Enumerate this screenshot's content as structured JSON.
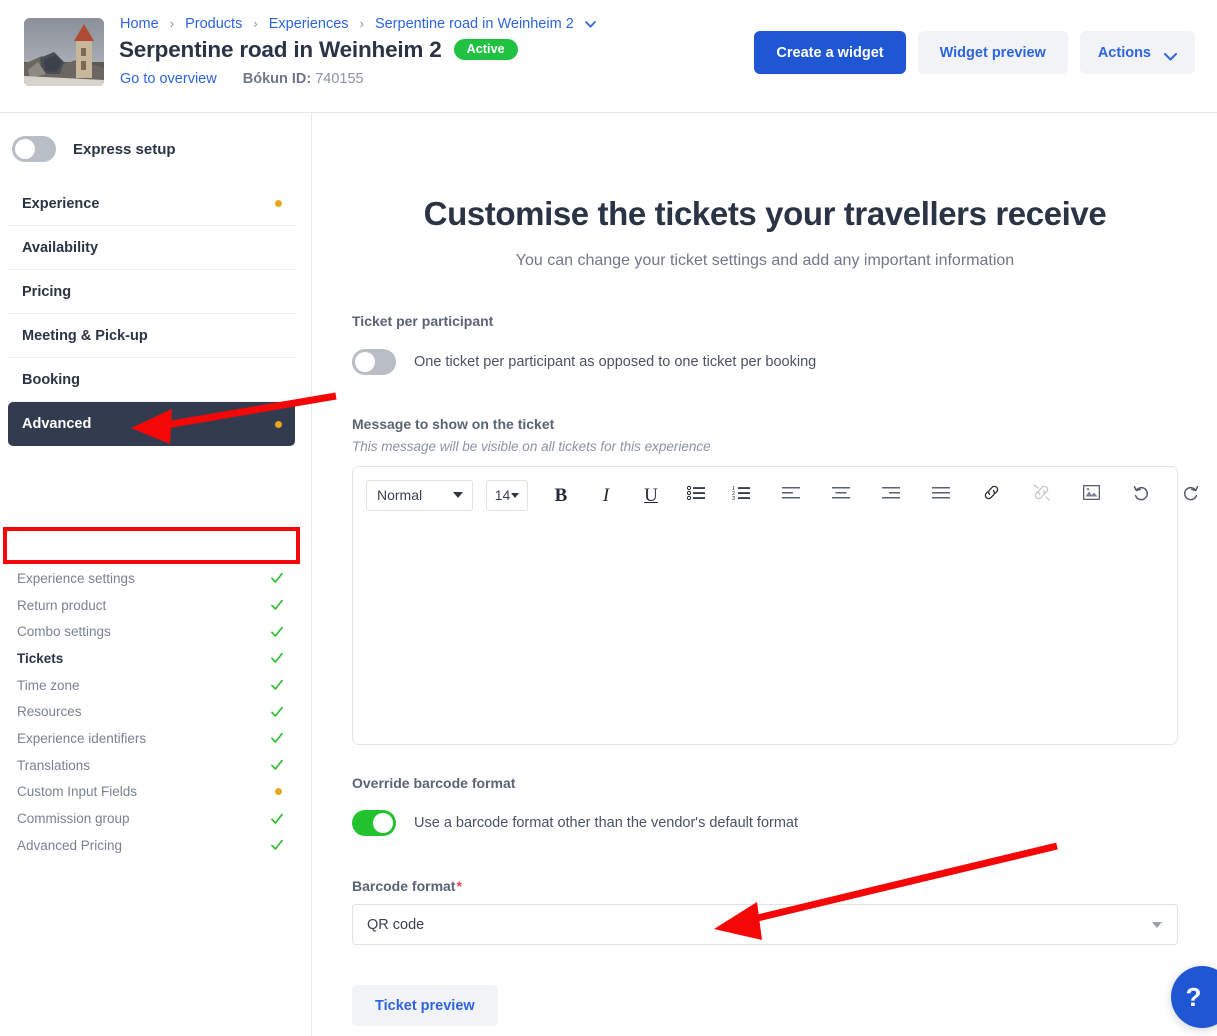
{
  "header": {
    "thumbnail_alt": "castle tower photo thumbnail",
    "breadcrumb": [
      {
        "label": "Home",
        "link": true
      },
      {
        "label": "Products",
        "link": true
      },
      {
        "label": "Experiences",
        "link": true
      },
      {
        "label": "Serpentine road in Weinheim 2",
        "link": true,
        "caret": true
      }
    ],
    "breadcrumb_separator": "›",
    "title": "Serpentine road in Weinheim 2",
    "status_badge": "Active",
    "status_badge_color": "#21c141",
    "overview_link": "Go to overview",
    "bokun_id_label": "Bókun ID:",
    "bokun_id_value": "740155",
    "actions": {
      "create_widget": "Create a widget",
      "widget_preview": "Widget preview",
      "actions_menu": "Actions"
    },
    "primary_color": "#1f56d3"
  },
  "sidebar": {
    "express_setup_label": "Express setup",
    "express_setup_on": false,
    "nav_items": [
      {
        "label": "Experience",
        "active": false,
        "dot": true
      },
      {
        "label": "Availability",
        "active": false,
        "dot": false
      },
      {
        "label": "Pricing",
        "active": false,
        "dot": false
      },
      {
        "label": "Meeting & Pick-up",
        "active": false,
        "dot": false
      },
      {
        "label": "Booking",
        "active": false,
        "dot": false
      },
      {
        "label": "Advanced",
        "active": true,
        "dot": true
      }
    ],
    "sub_items": [
      {
        "label": "Experience settings",
        "status": "check",
        "current": false
      },
      {
        "label": "Return product",
        "status": "check",
        "current": false
      },
      {
        "label": "Combo settings",
        "status": "check",
        "current": false
      },
      {
        "label": "Tickets",
        "status": "check",
        "current": true
      },
      {
        "label": "Time zone",
        "status": "check",
        "current": false
      },
      {
        "label": "Resources",
        "status": "check",
        "current": false
      },
      {
        "label": "Experience identifiers",
        "status": "check",
        "current": false
      },
      {
        "label": "Translations",
        "status": "check",
        "current": false
      },
      {
        "label": "Custom Input Fields",
        "status": "dot",
        "current": false
      },
      {
        "label": "Commission group",
        "status": "check",
        "current": false
      },
      {
        "label": "Advanced Pricing",
        "status": "check",
        "current": false
      }
    ],
    "check_color": "#2fbf2f",
    "dot_color": "#e8a81c",
    "active_bg": "#333c4e"
  },
  "main": {
    "heading": "Customise the tickets your travellers receive",
    "subheading": "You can change your ticket settings and add any important information",
    "ticket_per_participant": {
      "label": "Ticket per participant",
      "toggle_label": "One ticket per participant as opposed to one ticket per booking",
      "on": false
    },
    "message": {
      "label": "Message to show on the ticket",
      "hint": "This message will be visible on all tickets for this experience",
      "body_value": "",
      "toolbar": {
        "block_format": "Normal",
        "font_size": "14",
        "buttons": [
          {
            "name": "bold",
            "glyph": "B"
          },
          {
            "name": "italic",
            "glyph": "I"
          },
          {
            "name": "underline",
            "glyph": "U"
          },
          {
            "name": "bullet-list"
          },
          {
            "name": "numbered-list"
          },
          {
            "name": "align-left"
          },
          {
            "name": "align-center"
          },
          {
            "name": "align-right"
          },
          {
            "name": "align-justify"
          },
          {
            "name": "insert-link"
          },
          {
            "name": "remove-link",
            "disabled": true
          },
          {
            "name": "insert-image"
          },
          {
            "name": "undo"
          },
          {
            "name": "redo"
          }
        ]
      }
    },
    "override_barcode": {
      "label": "Override barcode format",
      "toggle_label": "Use a barcode format other than the vendor's default format",
      "on": true,
      "on_color": "#22c32f"
    },
    "barcode_format": {
      "label": "Barcode format",
      "required_mark": "*",
      "selected_value": "QR code"
    },
    "ticket_preview_button": "Ticket preview"
  },
  "help": {
    "glyph": "?",
    "color": "#1f56d3"
  },
  "annotations": {
    "arrow_color": "#f50707",
    "highlight_box_color": "#f50707",
    "arrow_1_target": "Advanced sidebar item",
    "arrow_2_target": "Barcode format select",
    "highlight_box_target": "Tickets sub-item"
  }
}
